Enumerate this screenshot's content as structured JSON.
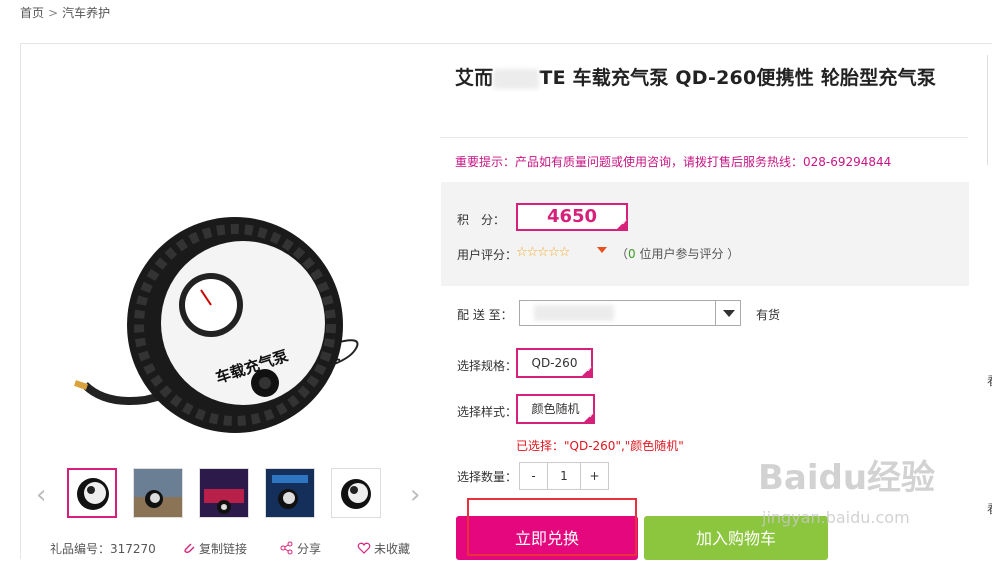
{
  "breadcrumb": {
    "home": "首页",
    "sep": ">",
    "current": "汽车养护"
  },
  "product": {
    "title_prefix": "艾而",
    "title_main": "TE 车载充气泵 QD-260便携性 轮胎型充气泵",
    "notice": "重要提示：产品如有质量问题或使用咨询，请拨打售后服务热线：028-69294844",
    "image_caption": "车载充气泵"
  },
  "price": {
    "label": "积　分：",
    "points": "4650"
  },
  "rating": {
    "label": "用户评分：",
    "stars": "☆☆☆☆☆",
    "count_prefix": "（",
    "count": "0",
    "count_suffix": " 位用户参与评分 ）",
    "rating_value": 0
  },
  "shipping": {
    "label": "配 送 至：",
    "stock": "有货"
  },
  "spec": {
    "label": "选择规格：",
    "value": "QD-260"
  },
  "style": {
    "label": "选择样式：",
    "value": "颜色随机"
  },
  "selected": "已选择：\"QD-260\",\"颜色随机\"",
  "quantity": {
    "label": "选择数量：",
    "minus": "-",
    "value": "1",
    "plus": "+"
  },
  "buttons": {
    "redeem": "立即兑换",
    "cart": "加入购物车"
  },
  "meta": {
    "gift_no": "礼品编号：317270",
    "copy_link": "复制链接",
    "share": "分享",
    "favorite": "未收藏"
  },
  "nav": {
    "prev": "‹",
    "next": "›"
  },
  "rail_chars": [
    "看",
    "看"
  ],
  "watermark": {
    "brand": "Baidu经验",
    "site": "jingyan.baidu.com"
  },
  "colors": {
    "accent": "#d6217a",
    "cart": "#8cc63f",
    "notice": "#c71585",
    "selected": "#e0161f"
  }
}
